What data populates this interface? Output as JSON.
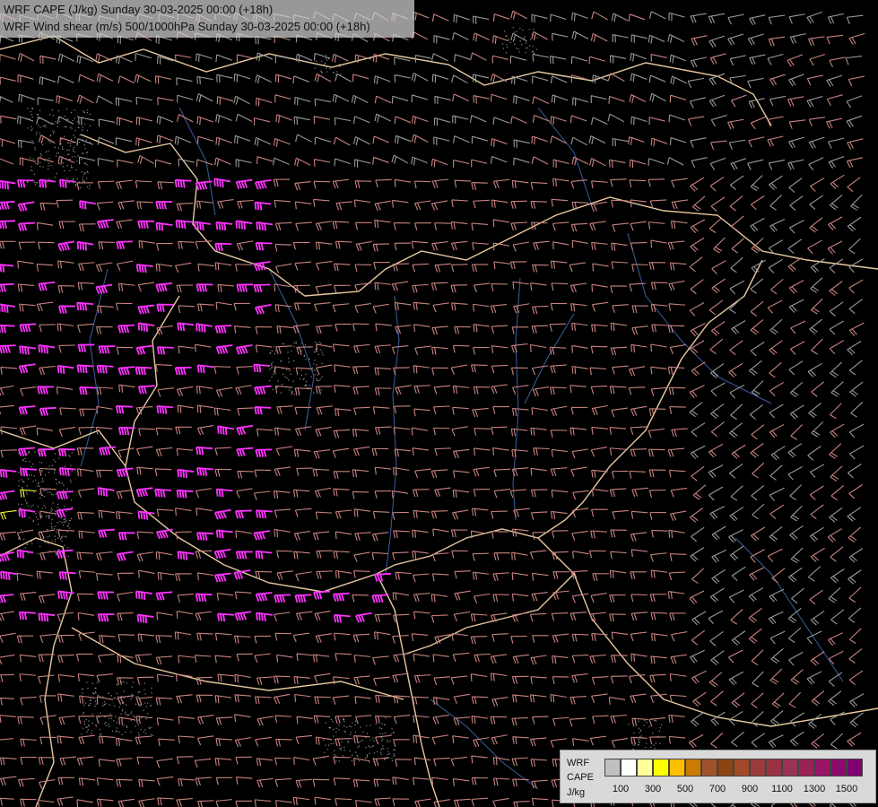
{
  "title": {
    "line1": "WRF CAPE (J/kg) Sunday 30-03-2025 00:00 (+18h)",
    "line2": "WRF Wind shear (m/s) 500/1000hPa Sunday 30-03-2025 00:00 (+18h)"
  },
  "legend": {
    "labels": [
      "WRF",
      "CAPE",
      "J/kg"
    ],
    "colors": [
      "#c0c0c0",
      "#ffffff",
      "#ffff99",
      "#ffff00",
      "#ffbf00",
      "#cc7a00",
      "#a0522d",
      "#8b4513",
      "#a04a2a",
      "#9a3b3b",
      "#993344",
      "#993355",
      "#992255",
      "#991466",
      "#8b0a6b",
      "#80006f"
    ],
    "ticks": [
      "100",
      "300",
      "500",
      "700",
      "900",
      "1100",
      "1300",
      "1500"
    ]
  },
  "colors": {
    "background": "#000000",
    "border": "#e8c9a0",
    "river": "#3a5fa0",
    "barb_low": "#9a9a9a",
    "barb_mid": "#c98480",
    "barb_high": "#ff33ff",
    "cape_yellow": "#ffff33"
  }
}
